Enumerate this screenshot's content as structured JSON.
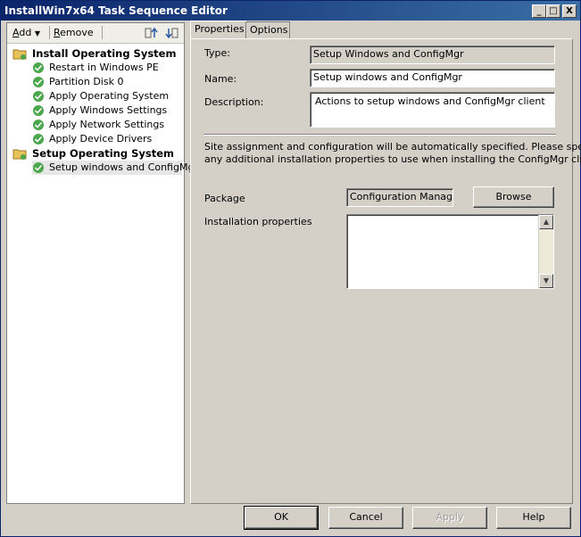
{
  "window": {
    "title": "InstallWin7x64 Task Sequence Editor",
    "controls": [
      "_",
      "□",
      "X"
    ]
  },
  "toolbar": {
    "add_u": "A",
    "add_rest": "dd",
    "remove_u": "R",
    "remove_rest": "emove",
    "icons": [
      "move-up-icon",
      "move-down-icon"
    ]
  },
  "tree": {
    "groups": [
      {
        "label": "Install Operating System",
        "items": [
          "Restart in Windows PE",
          "Partition Disk 0",
          "Apply Operating System",
          "Apply Windows Settings",
          "Apply Network Settings",
          "Apply Device Drivers"
        ]
      },
      {
        "label": "Setup Operating System",
        "items": [
          "Setup windows and ConfigMgr"
        ]
      }
    ],
    "selected": "Setup windows and ConfigMgr"
  },
  "tabs": [
    {
      "label": "Properties"
    },
    {
      "label": "Options"
    }
  ],
  "properties": {
    "type_label": "Type:",
    "type_value": "Setup Windows and ConfigMgr",
    "name_label": "Name:",
    "name_value": "Setup windows and ConfigMgr",
    "description_label": "Description:",
    "description_value": "Actions to setup windows and ConfigMgr client",
    "info_line1": "Site assignment and configuration will be automatically specified. Please specify",
    "info_line2": "any additional installation properties to use when installing the ConfigMgr client.",
    "package_label": "Package",
    "package_value": "Configuration Manager Client Package",
    "browse_label": "Browse",
    "install_props_label": "Installation properties",
    "install_props_value": ""
  },
  "buttons": {
    "ok": "OK",
    "cancel": "Cancel",
    "apply": "Apply",
    "help": "Help"
  }
}
